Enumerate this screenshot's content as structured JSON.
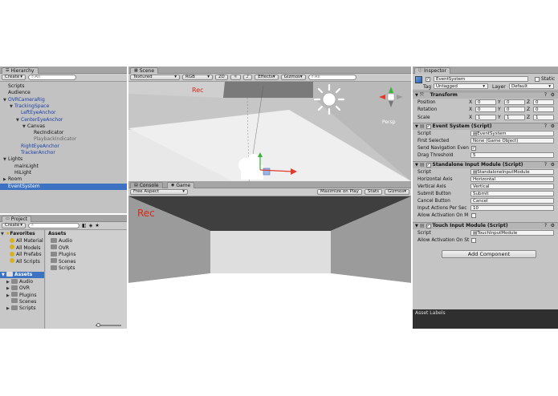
{
  "hierarchy": {
    "tab_label": "Hierarchy",
    "create_label": "Create",
    "search_placeholder": "All",
    "items": [
      {
        "label": "Scripts",
        "indent": 0,
        "arrow": "",
        "style": ""
      },
      {
        "label": "Audience",
        "indent": 0,
        "arrow": "",
        "style": ""
      },
      {
        "label": "OVRCameraRig",
        "indent": 0,
        "arrow": "▼",
        "style": "blue"
      },
      {
        "label": "TrackingSpace",
        "indent": 1,
        "arrow": "▼",
        "style": "blue"
      },
      {
        "label": "LeftEyeAnchor",
        "indent": 2,
        "arrow": "",
        "style": "blue"
      },
      {
        "label": "CenterEyeAnchor",
        "indent": 2,
        "arrow": "▼",
        "style": "blue"
      },
      {
        "label": "Canvas",
        "indent": 3,
        "arrow": "▼",
        "style": ""
      },
      {
        "label": "RecIndicator",
        "indent": 4,
        "arrow": "",
        "style": ""
      },
      {
        "label": "PlaybackIndicator",
        "indent": 4,
        "arrow": "",
        "style": "gray"
      },
      {
        "label": "RightEyeAnchor",
        "indent": 2,
        "arrow": "",
        "style": "blue"
      },
      {
        "label": "TrackerAnchor",
        "indent": 2,
        "arrow": "",
        "style": "blue"
      },
      {
        "label": "Lights",
        "indent": 0,
        "arrow": "▼",
        "style": ""
      },
      {
        "label": "mainLight",
        "indent": 1,
        "arrow": "",
        "style": ""
      },
      {
        "label": "HiLight",
        "indent": 1,
        "arrow": "",
        "style": ""
      },
      {
        "label": "Room",
        "indent": 0,
        "arrow": "▶",
        "style": ""
      },
      {
        "label": "EventSystem",
        "indent": 0,
        "arrow": "",
        "style": "sel"
      }
    ]
  },
  "project": {
    "tab_label": "Project",
    "create_label": "Create",
    "favorites_label": "Favorites",
    "favorites": [
      "All Material",
      "All Models",
      "All Prefabs",
      "All Scripts"
    ],
    "assets_root": "Assets",
    "asset_tree": [
      "Audio",
      "OVR",
      "Plugins",
      "Scenes",
      "Scripts"
    ],
    "assets_header": "Assets",
    "assets_list": [
      "Audio",
      "OVR",
      "Plugins",
      "Scenes",
      "Scripts"
    ]
  },
  "scene": {
    "tab_label": "Scene",
    "shading": "Textured",
    "render_mode": "RGB",
    "mode_2d": "2D",
    "effects": "Effects",
    "gizmos": "Gizmos",
    "search_placeholder": "All",
    "rec_text": "Rec",
    "persp_label": "Persp"
  },
  "game": {
    "console_tab": "Console",
    "game_tab": "Game",
    "aspect": "Free Aspect",
    "maximize": "Maximize on Play",
    "stats": "Stats",
    "gizmos": "Gizmos",
    "rec_text": "Rec"
  },
  "inspector": {
    "tab_label": "Inspector",
    "object_name": "EventSystem",
    "static_label": "Static",
    "tag_label": "Tag",
    "tag_value": "Untagged",
    "layer_label": "Layer",
    "layer_value": "Default",
    "transform": {
      "title": "Transform",
      "position_label": "Position",
      "rotation_label": "Rotation",
      "scale_label": "Scale",
      "x": "X",
      "y": "Y",
      "z": "Z",
      "position": [
        "0",
        "0",
        "0"
      ],
      "rotation": [
        "0",
        "0",
        "0"
      ],
      "scale": [
        "1",
        "1",
        "1"
      ]
    },
    "event_system": {
      "title": "Event System (Script)",
      "script_label": "Script",
      "script_value": "EventSystem",
      "first_selected_label": "First Selected",
      "first_selected_value": "None (Game Object)",
      "send_nav_label": "Send Navigation Even",
      "drag_threshold_label": "Drag Threshold",
      "drag_threshold_value": "5"
    },
    "standalone": {
      "title": "Standalone Input Module (Script)",
      "script_label": "Script",
      "script_value": "StandaloneInputModule",
      "horizontal_label": "Horizontal Axis",
      "horizontal_value": "Horizontal",
      "vertical_label": "Vertical Axis",
      "vertical_value": "Vertical",
      "submit_label": "Submit Button",
      "submit_value": "Submit",
      "cancel_label": "Cancel Button",
      "cancel_value": "Cancel",
      "input_actions_label": "Input Actions Per Sec",
      "input_actions_value": "10",
      "allow_activation_label": "Allow Activation On M"
    },
    "touch": {
      "title": "Touch Input Module (Script)",
      "script_label": "Script",
      "script_value": "TouchInputModule",
      "allow_activation_label": "Allow Activation On St"
    },
    "add_component": "Add Component",
    "asset_labels": "Asset Labels"
  }
}
